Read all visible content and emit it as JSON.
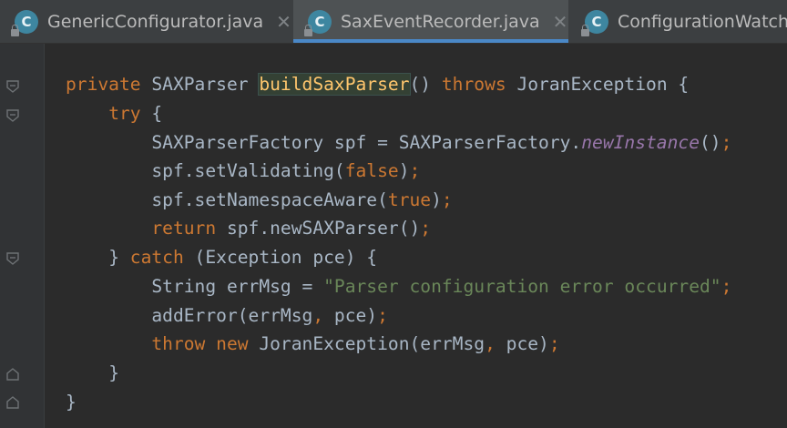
{
  "tabs": [
    {
      "icon": "class-icon",
      "icon_letter": "C",
      "title": "GenericConfigurator.java",
      "close": "✕",
      "active": false
    },
    {
      "icon": "class-icon",
      "icon_letter": "C",
      "title": "SaxEventRecorder.java",
      "close": "✕",
      "active": true
    },
    {
      "icon": "class-icon",
      "icon_letter": "C",
      "title": "ConfigurationWatch",
      "active": false
    }
  ],
  "code": {
    "l1": {
      "kw1": "private",
      "t1": " SAXParser ",
      "fn": "buildSaxParser",
      "t2": "() ",
      "kw2": "throws",
      "t3": " JoranException {"
    },
    "l2": {
      "indent": "    ",
      "kw1": "try",
      "t1": " {"
    },
    "l3": {
      "indent": "        ",
      "t1": "SAXParserFactory spf = SAXParserFactory.",
      "sm": "newInstance",
      "t2": "()",
      "semi": ";"
    },
    "l4": {
      "indent": "        ",
      "t1": "spf.setValidating(",
      "kw1": "false",
      "t2": ")",
      "semi": ";"
    },
    "l5": {
      "indent": "        ",
      "t1": "spf.setNamespaceAware(",
      "kw1": "true",
      "t2": ")",
      "semi": ";"
    },
    "l6": {
      "indent": "        ",
      "kw1": "return",
      "t1": " spf.newSAXParser()",
      "semi": ";"
    },
    "l7": {
      "indent": "    ",
      "t1": "} ",
      "kw1": "catch",
      "t2": " (Exception pce) {"
    },
    "l8": {
      "indent": "        ",
      "t1": "String errMsg = ",
      "str": "\"Parser configuration error occurred\"",
      "semi": ";"
    },
    "l9": {
      "indent": "        ",
      "t1": "addError(errMsg",
      "comma": ",",
      "t2": " pce)",
      "semi": ";"
    },
    "l10": {
      "indent": "        ",
      "kw1": "throw",
      "t0": " ",
      "kw2": "new",
      "t1": " JoranException(errMsg",
      "comma": ",",
      "t2": " pce)",
      "semi": ";"
    },
    "l11": {
      "indent": "    ",
      "t1": "}"
    },
    "l12": {
      "indent": "",
      "t1": "}"
    }
  },
  "colors": {
    "keyword": "#cc7832",
    "method_decl": "#ffc66d",
    "static_method": "#9876aa",
    "string": "#6a8759",
    "plain": "#a9b7c6",
    "active_tab_underline": "#4a88c7"
  }
}
